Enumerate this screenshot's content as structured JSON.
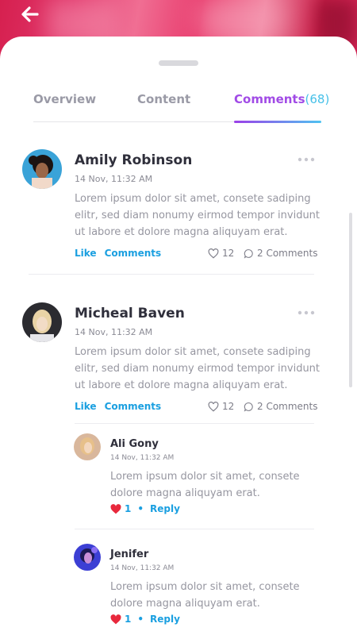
{
  "tabs": {
    "overview": "Overview",
    "content": "Content",
    "comments": "Comments",
    "comments_count": "(68)"
  },
  "comments": [
    {
      "author": "Amily Robinson",
      "time": "14 Nov, 11:32 AM",
      "body": "Lorem ipsum dolor sit amet, consete sadiping elitr, sed diam nonumy eirmod tempor invidunt ut labore et dolore magna aliquyam erat.",
      "like_label": "Like",
      "comments_label": "Comments",
      "likes": "12",
      "comment_count": "2 Comments"
    },
    {
      "author": "Micheal Baven",
      "time": "14 Nov, 11:32 AM",
      "body": "Lorem ipsum dolor sit amet, consete sadiping elitr, sed diam nonumy eirmod tempor invidunt ut labore et dolore magna aliquyam erat.",
      "like_label": "Like",
      "comments_label": "Comments",
      "likes": "12",
      "comment_count": "2 Comments"
    }
  ],
  "replies": [
    {
      "author": "Ali Gony",
      "time": "14 Nov, 11:32 AM",
      "body": "Lorem ipsum dolor sit amet, consete dolore magna aliquyam erat.",
      "likes": "1",
      "separator": "•",
      "reply_label": "Reply"
    },
    {
      "author": "Jenifer",
      "time": "14 Nov, 11:32 AM",
      "body": "Lorem ipsum dolor sit amet, consete dolore magna aliquyam erat.",
      "likes": "1",
      "separator": "•",
      "reply_label": "Reply"
    }
  ],
  "colors": {
    "accent_purple": "#a14be6",
    "accent_blue": "#1a9fe0",
    "heart_red": "#e8283c",
    "hero_pink": "#e0356a"
  },
  "icons": {
    "back": "arrow-left-icon",
    "more": "more-dots-icon",
    "heart": "heart-icon",
    "comment": "comment-bubble-icon"
  }
}
